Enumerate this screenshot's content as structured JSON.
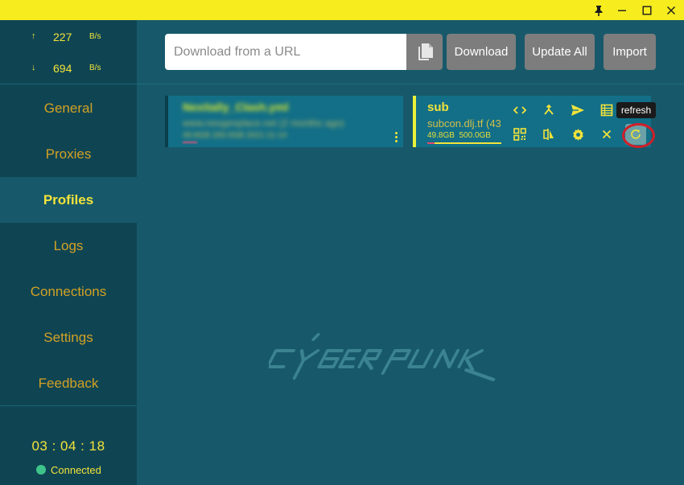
{
  "window": {
    "pin_icon": "pin-icon",
    "minimize_icon": "minimize-icon",
    "maximize_icon": "maximize-icon",
    "close_icon": "close-icon"
  },
  "traffic": {
    "upload": {
      "arrow": "↑",
      "value": "227",
      "unit": "B/s"
    },
    "download": {
      "arrow": "↓",
      "value": "694",
      "unit": "B/s"
    }
  },
  "nav": {
    "items": [
      {
        "id": "general",
        "label": "General",
        "active": false
      },
      {
        "id": "proxies",
        "label": "Proxies",
        "active": false
      },
      {
        "id": "profiles",
        "label": "Profiles",
        "active": true
      },
      {
        "id": "logs",
        "label": "Logs",
        "active": false
      },
      {
        "id": "connections",
        "label": "Connections",
        "active": false
      },
      {
        "id": "settings",
        "label": "Settings",
        "active": false
      },
      {
        "id": "feedback",
        "label": "Feedback",
        "active": false
      }
    ]
  },
  "status": {
    "clock": "03 : 04 : 18",
    "connection": "Connected"
  },
  "toolbar": {
    "url_placeholder": "Download from a URL",
    "url_value": "",
    "paste_icon": "copy-paste-icon",
    "download_label": "Download",
    "update_all_label": "Update All",
    "import_label": "Import"
  },
  "profiles": [
    {
      "name": "Nexitally_Clash.yml",
      "url": "www.nexgenplace.net (2 months ago)",
      "usage": "49.8GB  200.0GB  2021-11-14",
      "selected": false
    },
    {
      "name": "sub",
      "url": "subcon.dlj.tf (43",
      "usage_used": "49.8GB",
      "usage_total": "500.0GB",
      "usage_fraction": 0.1,
      "selected": true
    }
  ],
  "profile_actions": [
    {
      "icon": "code-icon",
      "label": "edit"
    },
    {
      "icon": "merge-icon",
      "label": "parsers"
    },
    {
      "icon": "send-icon",
      "label": "select"
    },
    {
      "icon": "table-icon",
      "label": "view"
    },
    {
      "icon": "qr-code-icon",
      "label": "qr code"
    },
    {
      "icon": "compare-icon",
      "label": "compare"
    },
    {
      "icon": "gear-icon",
      "label": "settings"
    },
    {
      "icon": "close-icon",
      "label": "delete"
    },
    {
      "icon": "refresh-icon",
      "label": "refresh"
    }
  ],
  "tooltip": "refresh",
  "colors": {
    "accent": "#f3e33a",
    "nav_text": "#d3a124",
    "sidebar_bg": "#0f4553",
    "main_bg": "#17596a",
    "card_bg": "#126f87",
    "highlight_ring": "#d0202a",
    "connected_dot": "#3ec48a"
  },
  "background_logo": "cyberpunk-logo"
}
